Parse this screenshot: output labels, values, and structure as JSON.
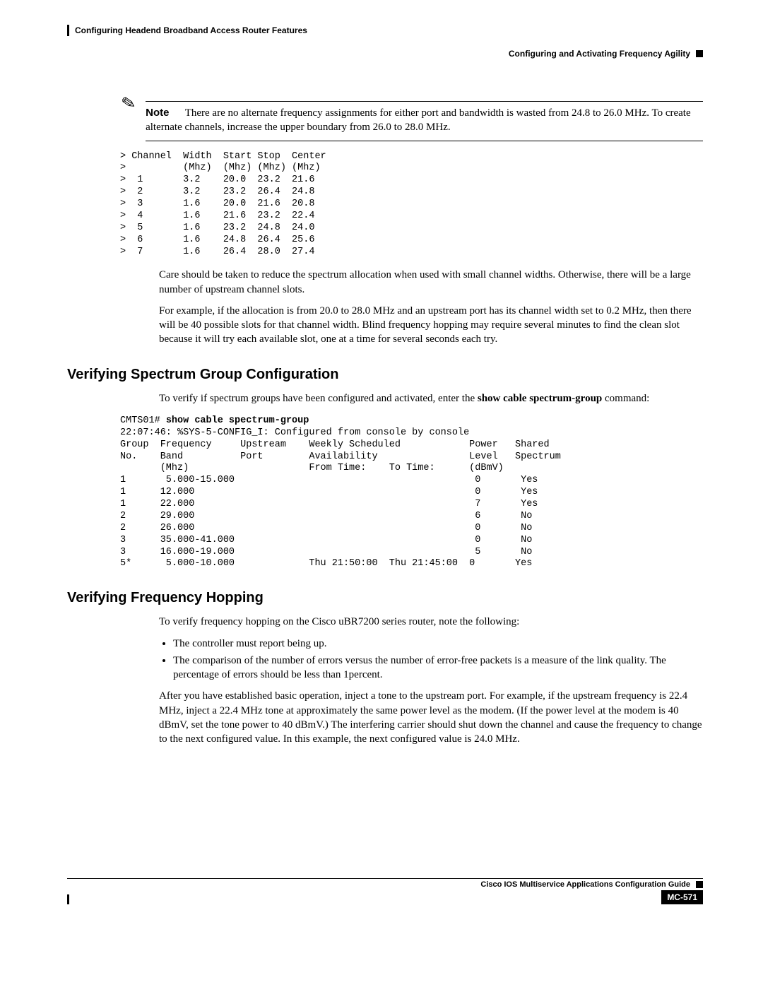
{
  "header": {
    "chapter": "Configuring Headend Broadband Access Router Features",
    "section": "Configuring and Activating Frequency Agility"
  },
  "note": {
    "label": "Note",
    "text": "There are no alternate frequency assignments for either port and bandwidth is wasted from 24.8 to 26.0 MHz. To create alternate channels, increase the upper boundary from 26.0 to 28.0 MHz."
  },
  "channel_table": "> Channel  Width  Start Stop  Center\n>          (Mhz)  (Mhz) (Mhz) (Mhz)\n>  1       3.2    20.0  23.2  21.6\n>  2       3.2    23.2  26.4  24.8\n>  3       1.6    20.0  21.6  20.8\n>  4       1.6    21.6  23.2  22.4\n>  5       1.6    23.2  24.8  24.0\n>  6       1.6    24.8  26.4  25.6\n>  7       1.6    26.4  28.0  27.4",
  "para_care": "Care should be taken to reduce the spectrum allocation when used with small channel widths. Otherwise, there will be a large number of upstream channel slots.",
  "para_example": "For example, if the allocation is from 20.0 to 28.0 MHz and an upstream port has its channel width set to 0.2 MHz, then there will be 40 possible slots for that channel width. Blind frequency hopping may require several minutes to find the clean slot because it will try each available slot, one at a time for several seconds each try.",
  "heading_verify_sg": "Verifying Spectrum Group Configuration",
  "para_verify_sg_pre": "To verify if spectrum groups have been configured and activated, enter the ",
  "cmd_show": "show cable spectrum-group",
  "para_verify_sg_post": " command:",
  "cli_prompt": "CMTS01# ",
  "cli_cmd": "show cable spectrum-group",
  "cli_output": "22:07:46: %SYS-5-CONFIG_I: Configured from console by console\nGroup  Frequency     Upstream    Weekly Scheduled            Power   Shared\nNo.    Band          Port        Availability                Level   Spectrum\n       (Mhz)                     From Time:    To Time:      (dBmV)\n1       5.000-15.000                                          0       Yes\n1      12.000                                                 0       Yes\n1      22.000                                                 7       Yes\n2      29.000                                                 6       No\n2      26.000                                                 0       No\n3      35.000-41.000                                          0       No\n3      16.000-19.000                                          5       No\n5*      5.000-10.000             Thu 21:50:00  Thu 21:45:00  0       Yes",
  "heading_verify_fh": "Verifying Frequency Hopping",
  "para_verify_fh": "To verify frequency hopping on the Cisco uBR7200 series router, note the following:",
  "bullets": [
    "The controller must report being up.",
    "The comparison of the number of errors versus the number of error-free packets is a measure of the link quality. The percentage of errors should be less than 1percent."
  ],
  "para_after": "After you have established basic operation, inject a tone to the upstream port. For example, if the upstream frequency is 22.4 MHz, inject a 22.4 MHz tone at approximately the same power level as the modem. (If the power level at the modem is 40 dBmV, set the tone power to 40 dBmV.) The interfering carrier should shut down the channel and cause the frequency to change to the next configured value. In this example, the next configured value is 24.0 MHz.",
  "footer": {
    "guide": "Cisco IOS Multiservice Applications Configuration Guide",
    "page": "MC-571"
  }
}
